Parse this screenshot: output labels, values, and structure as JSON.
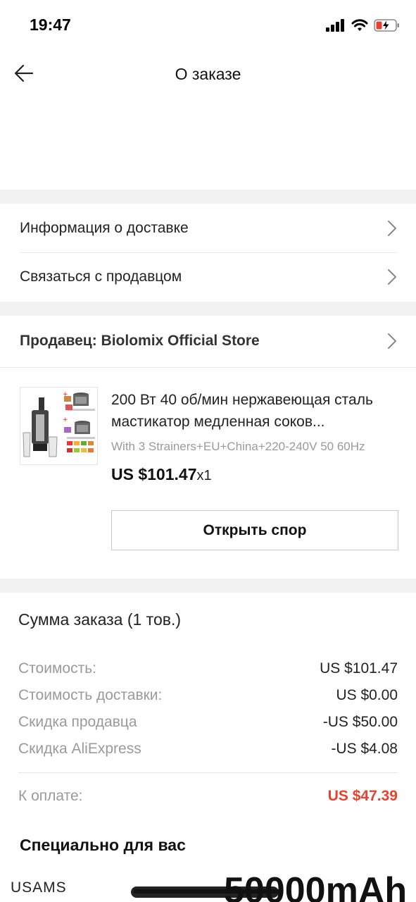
{
  "status_bar": {
    "time": "19:47"
  },
  "header": {
    "title": "О заказе"
  },
  "menu": {
    "delivery_info": "Информация о доставке",
    "contact_seller": "Связаться с продавцом"
  },
  "seller": {
    "label": "Продавец: Biolomix Official Store"
  },
  "product": {
    "title": "200 Вт 40 об/мин нержавеющая сталь мастикатор медленная соков...",
    "variant": "With 3 Strainers+EU+China+220-240V 50 60Hz",
    "price": "US $101.47",
    "quantity": "x1",
    "dispute_button": "Открыть спор"
  },
  "summary": {
    "title": "Сумма заказа (1 тов.)",
    "rows": [
      {
        "label": "Стоимость:",
        "value": "US $101.47"
      },
      {
        "label": "Стоимость доставки:",
        "value": "US $0.00"
      },
      {
        "label": "Скидка продавца",
        "value": "-US $50.00"
      },
      {
        "label": "Скидка AliExpress",
        "value": "-US $4.08"
      }
    ],
    "total_label": "К оплате:",
    "total_value": "US $47.39",
    "total_color": "#e8412c"
  },
  "recommendations": {
    "title": "Специально для вас",
    "promo_brand": "USAMS",
    "promo_text": "50000mAh"
  },
  "icons": {
    "back": "arrow-left-icon",
    "chevron": "chevron-right-icon",
    "signal": "signal-icon",
    "wifi": "wifi-icon",
    "battery": "battery-charging-icon"
  }
}
